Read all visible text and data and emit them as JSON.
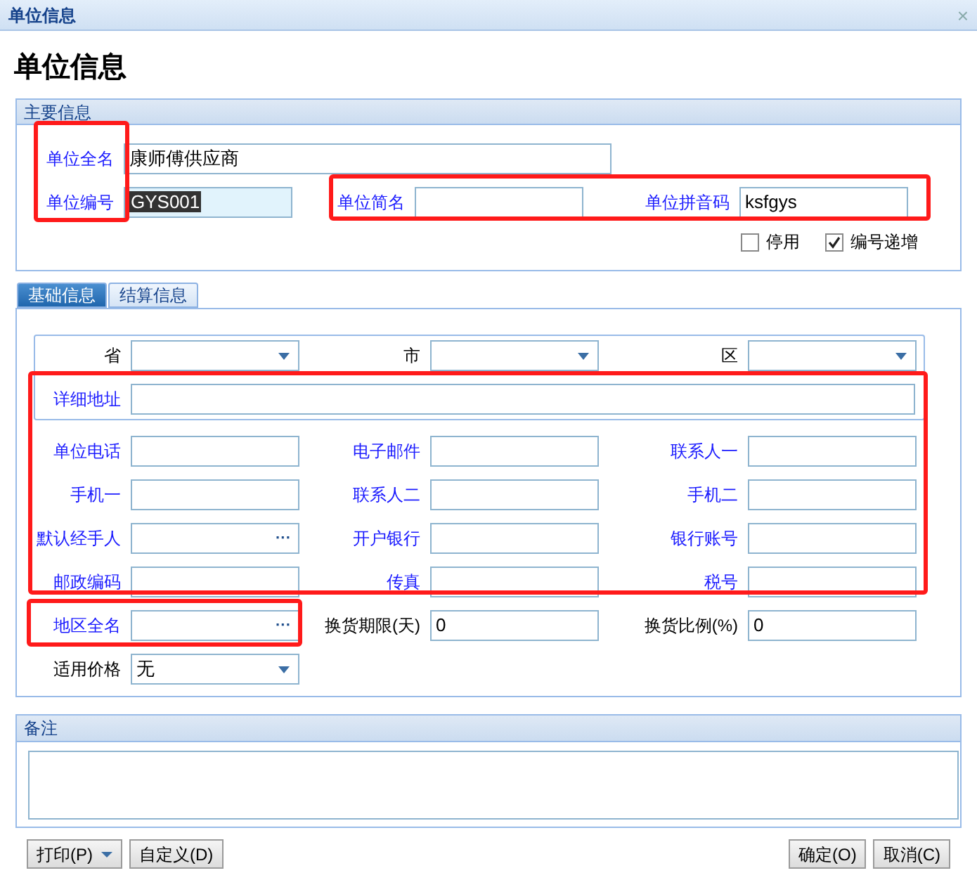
{
  "window": {
    "title": "单位信息",
    "close": "×"
  },
  "heading": "单位信息",
  "main_section": {
    "title": "主要信息",
    "rows": [
      [
        {
          "label": "单位全名",
          "required": true,
          "kind": "text",
          "value": "康师傅供应商"
        }
      ],
      [
        {
          "label": "单位编号",
          "required": true,
          "kind": "text",
          "value": "GYS001",
          "value_selected": true,
          "focused": true
        },
        {
          "label": "单位简名",
          "required": true,
          "kind": "text"
        },
        {
          "label": "单位拼音码",
          "required": true,
          "kind": "text",
          "value": "ksfgys"
        }
      ]
    ],
    "checkboxes": [
      {
        "label": "停用",
        "checked": false
      },
      {
        "label": "编号递增",
        "checked": true
      }
    ]
  },
  "tabs": [
    {
      "label": "基础信息",
      "selected": true
    },
    {
      "label": "结算信息",
      "selected": false
    }
  ],
  "address": {
    "rows": [
      [
        {
          "label": "省",
          "required": false,
          "kind": "select"
        },
        {
          "label": "市",
          "required": false,
          "kind": "select"
        },
        {
          "label": "区",
          "required": false,
          "kind": "select"
        }
      ],
      [
        {
          "label": "详细地址",
          "required": true,
          "kind": "wide"
        }
      ]
    ]
  },
  "fields": [
    [
      {
        "label": "单位电话",
        "required": true,
        "kind": "text"
      },
      {
        "label": "电子邮件",
        "required": true,
        "kind": "text"
      },
      {
        "label": "联系人一",
        "required": true,
        "kind": "text"
      }
    ],
    [
      {
        "label": "手机一",
        "required": true,
        "kind": "text"
      },
      {
        "label": "联系人二",
        "required": true,
        "kind": "text"
      },
      {
        "label": "手机二",
        "required": true,
        "kind": "text"
      }
    ],
    [
      {
        "label": "默认经手人",
        "required": true,
        "kind": "picker",
        "button": "···"
      },
      {
        "label": "开户银行",
        "required": true,
        "kind": "text"
      },
      {
        "label": "银行账号",
        "required": true,
        "kind": "text"
      }
    ],
    [
      {
        "label": "邮政编码",
        "required": true,
        "kind": "text"
      },
      {
        "label": "传真",
        "required": true,
        "kind": "text"
      },
      {
        "label": "税号",
        "required": true,
        "kind": "text"
      }
    ],
    [
      {
        "label": "地区全名",
        "required": true,
        "kind": "picker",
        "button": "···"
      },
      {
        "label": "换货期限(天)",
        "required": false,
        "kind": "text",
        "value": "0"
      },
      {
        "label": "换货比例(%)",
        "required": false,
        "kind": "text",
        "value": "0"
      }
    ],
    [
      {
        "label": "适用价格",
        "required": false,
        "kind": "select",
        "value": "无"
      }
    ]
  ],
  "notes": {
    "title": "备注"
  },
  "buttons": [
    {
      "label": "打印(P)",
      "dropdown": true
    },
    {
      "label": "自定义(D)",
      "dropdown": false
    },
    {
      "label": "确定(O)",
      "dropdown": false
    },
    {
      "label": "取消(C)",
      "dropdown": false
    }
  ],
  "annotations": [
    {
      "kind": "red-box"
    },
    {
      "kind": "red-box"
    },
    {
      "kind": "red-box"
    },
    {
      "kind": "red-box"
    }
  ]
}
